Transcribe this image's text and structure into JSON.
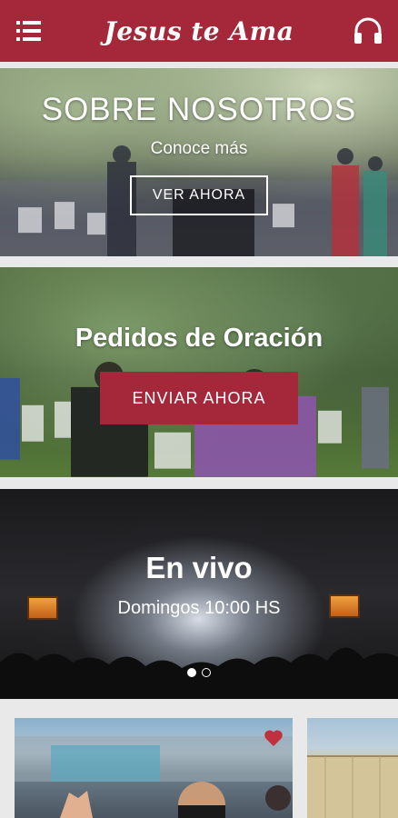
{
  "app": {
    "title": "Jesus te Ama"
  },
  "cards": {
    "about": {
      "title": "SOBRE NOSOTROS",
      "subtitle": "Conoce más",
      "button_label": "VER AHORA"
    },
    "prayer": {
      "title": "Pedidos de Oración",
      "button_label": "ENVIAR AHORA"
    },
    "live": {
      "title": "En vivo",
      "subtitle": "Domingos 10:00 HS",
      "carousel_active_index": 0,
      "carousel_count": 2
    }
  },
  "icons": {
    "menu": "menu-icon",
    "headset": "headset-icon",
    "favorite": "heart-icon"
  },
  "colors": {
    "brand": "#a5283a",
    "background": "#e9e9e9"
  }
}
